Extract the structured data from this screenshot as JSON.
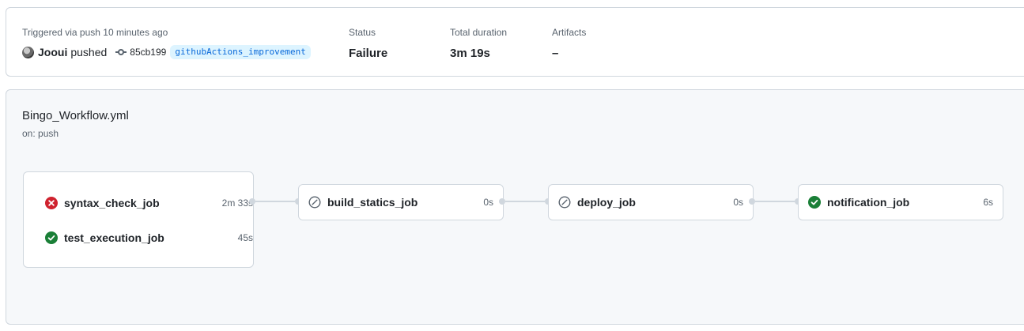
{
  "summary": {
    "trigger_label": "Triggered via push 10 minutes ago",
    "actor": "Jooui",
    "action": "pushed",
    "commit_sha": "85cb199",
    "branch": "githubActions_improvement",
    "status_label": "Status",
    "status_value": "Failure",
    "duration_label": "Total duration",
    "duration_value": "3m 19s",
    "artifacts_label": "Artifacts",
    "artifacts_value": "–"
  },
  "workflow": {
    "file": "Bingo_Workflow.yml",
    "trigger": "on: push",
    "jobs": [
      {
        "name": "syntax_check_job",
        "duration": "2m 33s",
        "status": "failure"
      },
      {
        "name": "test_execution_job",
        "duration": "45s",
        "status": "success"
      },
      {
        "name": "build_statics_job",
        "duration": "0s",
        "status": "skipped"
      },
      {
        "name": "deploy_job",
        "duration": "0s",
        "status": "skipped"
      },
      {
        "name": "notification_job",
        "duration": "6s",
        "status": "success"
      }
    ]
  },
  "colors": {
    "failure": "#cf222e",
    "success": "#1a7f37",
    "skipped": "#59636e",
    "link": "#0969da"
  }
}
